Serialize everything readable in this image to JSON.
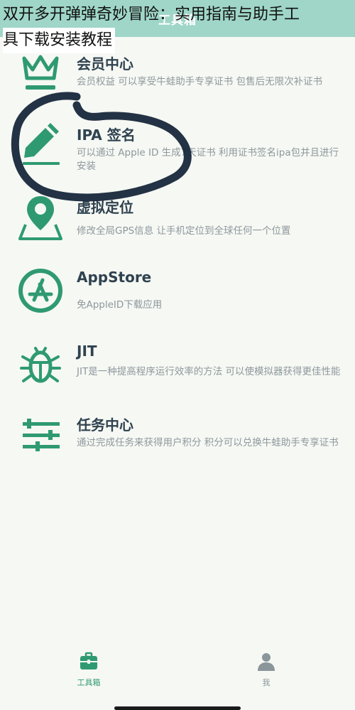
{
  "article_title": {
    "line1": "双开多开弹弹奇妙冒险：实用指南与助手工",
    "line2": "具下载安装教程"
  },
  "nav": {
    "title": "工具箱"
  },
  "items": [
    {
      "title": "会员中心",
      "desc": "会员权益 可以享受牛蛙助手专享证书 包售后无限次补证书",
      "icon": "crown-icon"
    },
    {
      "title": "IPA 签名",
      "desc": "可以通过 Apple ID 生成7天证书 利用证书签名ipa包并且进行安装",
      "icon": "pencil-icon"
    },
    {
      "title": "虚拟定位",
      "desc": "修改全局GPS信息 让手机定位到全球任何一个位置",
      "icon": "location-pin-icon"
    },
    {
      "title": "AppStore",
      "desc": "免AppleID下载应用",
      "icon": "appstore-icon"
    },
    {
      "title": "JIT",
      "desc": "JIT是一种提高程序运行效率的方法 可以使模拟器获得更佳性能",
      "icon": "bug-icon"
    },
    {
      "title": "任务中心",
      "desc": "通过完成任务来获得用户积分 积分可以兑换牛蛙助手专享证书",
      "icon": "sliders-icon"
    }
  ],
  "tabbar": {
    "tabs": [
      {
        "label": "工具箱",
        "icon": "toolbox-icon",
        "active": true
      },
      {
        "label": "我",
        "icon": "user-icon",
        "active": false
      }
    ]
  },
  "colors": {
    "accent": "#2f9a72",
    "navbar": "#9fd6c8",
    "background": "#f6f8f3"
  }
}
